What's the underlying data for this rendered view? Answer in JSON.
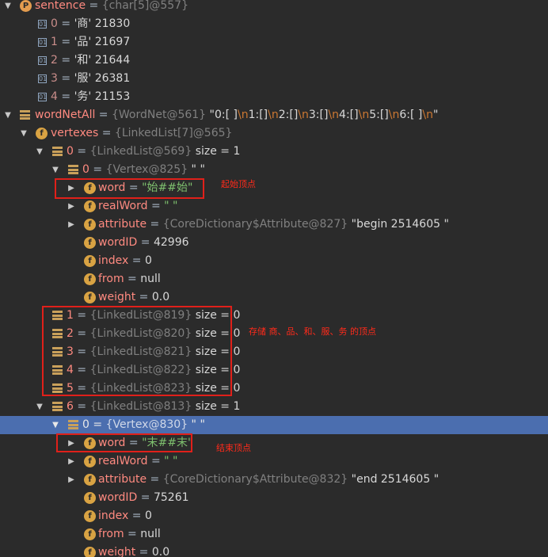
{
  "rows": [
    {
      "name": "sentence",
      "eq": " = ",
      "type": "{char[5]@557}",
      "value": ""
    },
    {
      "name": "0",
      "eq": " = ",
      "type": "",
      "value": "'商' 21830"
    },
    {
      "name": "1",
      "eq": " = ",
      "type": "",
      "value": "'品' 21697"
    },
    {
      "name": "2",
      "eq": " = ",
      "type": "",
      "value": "'和' 21644"
    },
    {
      "name": "3",
      "eq": " = ",
      "type": "",
      "value": "'服' 26381"
    },
    {
      "name": "4",
      "eq": " = ",
      "type": "",
      "value": "'务' 21153"
    },
    {
      "name": "wordNetAll",
      "eq": " = ",
      "type": "{WordNet@561}",
      "value": " \"0:[ ]\\n1:[]\\n2:[]\\n3:[]\\n4:[]\\n5:[]\\n6:[ ]\\n\""
    },
    {
      "name": "vertexes",
      "eq": " = ",
      "type": "{LinkedList[7]@565}",
      "value": ""
    },
    {
      "name": "0",
      "eq": " = ",
      "type": "{LinkedList@569}",
      "value": "  size = 1"
    },
    {
      "name": "0",
      "eq": " = ",
      "type": "{Vertex@825}",
      "value": " \" \""
    },
    {
      "name": "word",
      "eq": " = ",
      "type": "",
      "value": "\"始##始\""
    },
    {
      "name": "realWord",
      "eq": " = ",
      "type": "",
      "value": "\" \""
    },
    {
      "name": "attribute",
      "eq": " = ",
      "type": "{CoreDictionary$Attribute@827}",
      "value": " \"begin 2514605 \""
    },
    {
      "name": "wordID",
      "eq": " = ",
      "type": "",
      "value": "42996"
    },
    {
      "name": "index",
      "eq": " = ",
      "type": "",
      "value": "0"
    },
    {
      "name": "from",
      "eq": " = ",
      "type": "",
      "value": "null"
    },
    {
      "name": "weight",
      "eq": " = ",
      "type": "",
      "value": "0.0"
    },
    {
      "name": "1",
      "eq": " = ",
      "type": "{LinkedList@819}",
      "value": "  size = 0"
    },
    {
      "name": "2",
      "eq": " = ",
      "type": "{LinkedList@820}",
      "value": "  size = 0"
    },
    {
      "name": "3",
      "eq": " = ",
      "type": "{LinkedList@821}",
      "value": "  size = 0"
    },
    {
      "name": "4",
      "eq": " = ",
      "type": "{LinkedList@822}",
      "value": "  size = 0"
    },
    {
      "name": "5",
      "eq": " = ",
      "type": "{LinkedList@823}",
      "value": "  size = 0"
    },
    {
      "name": "6",
      "eq": " = ",
      "type": "{LinkedList@813}",
      "value": "  size = 1"
    },
    {
      "name": "0",
      "eq": " = ",
      "type": "{Vertex@830}",
      "value": " \" \""
    },
    {
      "name": "word",
      "eq": " = ",
      "type": "",
      "value": "\"末##末\""
    },
    {
      "name": "realWord",
      "eq": " = ",
      "type": "",
      "value": "\" \""
    },
    {
      "name": "attribute",
      "eq": " = ",
      "type": "{CoreDictionary$Attribute@832}",
      "value": " \"end 2514605 \""
    },
    {
      "name": "wordID",
      "eq": " = ",
      "type": "",
      "value": "75261"
    },
    {
      "name": "index",
      "eq": " = ",
      "type": "",
      "value": "0"
    },
    {
      "name": "from",
      "eq": " = ",
      "type": "",
      "value": "null"
    },
    {
      "name": "weight",
      "eq": " = ",
      "type": "",
      "value": "0.0"
    }
  ],
  "annotations": {
    "start_vertex": "起始顶点",
    "storage": "存储 商、品、和、服、务 的顶点",
    "end_vertex": "结束顶点"
  },
  "icons": {
    "field_letter": "f",
    "param_letter": "P",
    "array_letter": "01"
  },
  "colors": {
    "background": "#2b2b2b",
    "selection": "#4b6eaf",
    "highlight_box": "#e0201a",
    "annotation": "#ff2a1a"
  }
}
